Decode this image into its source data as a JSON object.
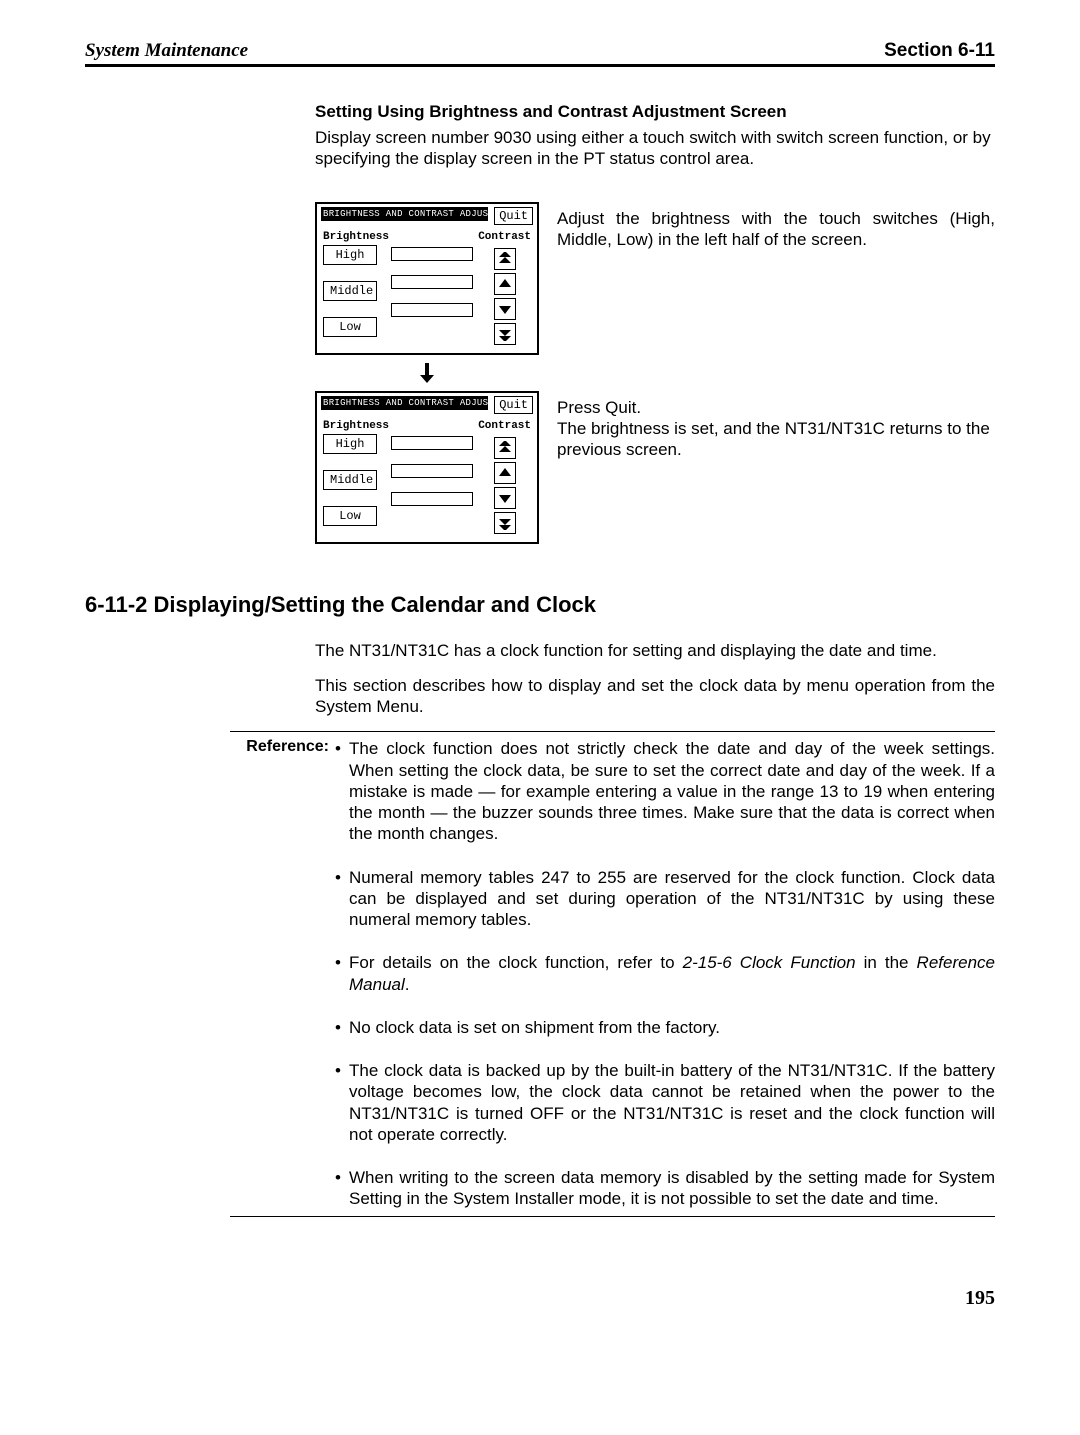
{
  "header": {
    "left": "System Maintenance",
    "right": "Section  6-11"
  },
  "section": {
    "title": "Setting Using Brightness and Contrast Adjustment Screen",
    "intro": "Display screen number 9030 using either a touch switch with switch screen function, or by specifying the display screen in the PT status control area."
  },
  "screen": {
    "title": "BRIGHTNESS AND CONTRAST ADJUST",
    "quit": "Quit",
    "brightness_label": "Brightness",
    "contrast_label": "Contrast",
    "levels": [
      "High",
      "Middle",
      "Low"
    ]
  },
  "caption1": "Adjust the brightness with the touch switches (High, Middle, Low) in the left half of the screen.",
  "caption2_line1": "Press Quit.",
  "caption2_line2": "The brightness is set, and the NT31/NT31C returns to the previous screen.",
  "subsection": {
    "heading": "6-11-2 Displaying/Setting the Calendar and Clock",
    "para1": "The NT31/NT31C has a clock function for setting and displaying the date and time.",
    "para2": "This section describes how to display and set the clock data by menu operation from the System Menu."
  },
  "reference": {
    "label": "Reference:",
    "items": [
      "The clock function does not strictly check the date and day of the week settings. When setting the clock data, be sure to set the correct date and day of the week. If a mistake is made — for example entering a value in the range 13 to 19 when entering the month — the buzzer sounds three times.\nMake sure that the data is correct when the month changes.",
      "Numeral memory tables 247 to 255 are reserved for the clock function. Clock data can be displayed and set during operation of the NT31/NT31C by using these numeral memory tables.",
      "For details on the clock function, refer to 2-15-6 Clock Function in the Reference Manual.",
      "No clock data is set on shipment from the factory.",
      "The clock data is backed up by the built-in battery of the NT31/NT31C. If the battery voltage becomes low, the clock data cannot be retained when the power to the NT31/NT31C is turned OFF or the NT31/NT31C is reset and the clock function will not operate correctly.",
      "When writing to the screen data memory is disabled by the setting made for System Setting in the System Installer mode, it is not possible to set the date and time."
    ],
    "item3_prefix": "For details on the clock function, refer to ",
    "item3_ref": "2-15-6 Clock Function",
    "item3_mid": " in the ",
    "item3_suffix_em": "Reference Manual",
    "item3_end": "."
  },
  "page_number": "195"
}
